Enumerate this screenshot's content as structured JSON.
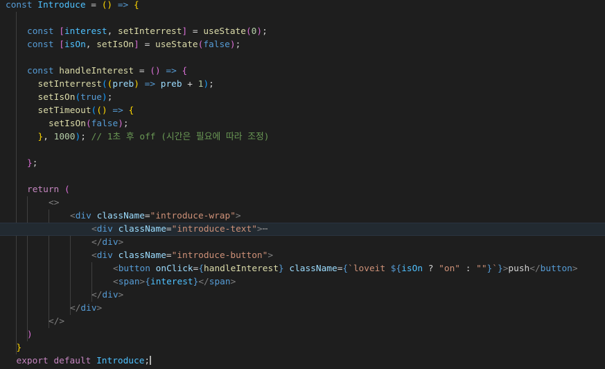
{
  "colors": {
    "background": "#1e1e1e",
    "keyword": "#569cd6",
    "control": "#c586c0",
    "function": "#dcdcaa",
    "variable": "#9cdcfe",
    "const_var": "#4fc1ff",
    "string": "#ce9178",
    "number": "#b5cea8",
    "comment": "#6a9955",
    "tag": "#569cd6",
    "tag_bracket": "#808080",
    "bracket_1": "#ffd700",
    "bracket_2": "#da70d6",
    "bracket_3": "#179fff",
    "text": "#d4d4d4"
  },
  "lines": [
    {
      "indent": 0,
      "tokens": [
        [
          "const ",
          "keyword"
        ],
        [
          "Introduce",
          "const_var"
        ],
        [
          " = ",
          "text"
        ],
        [
          "(",
          "bracket_1"
        ],
        [
          ")",
          "bracket_1"
        ],
        [
          " => ",
          "keyword"
        ],
        [
          "{",
          "bracket_1"
        ]
      ]
    },
    {
      "indent": 0,
      "tokens": []
    },
    {
      "indent": 2,
      "tokens": [
        [
          "const ",
          "keyword"
        ],
        [
          "[",
          "bracket_2"
        ],
        [
          "interest",
          "const_var"
        ],
        [
          ", ",
          "text"
        ],
        [
          "setInterrest",
          "function"
        ],
        [
          "]",
          "bracket_2"
        ],
        [
          " = ",
          "text"
        ],
        [
          "useState",
          "function"
        ],
        [
          "(",
          "bracket_2"
        ],
        [
          "0",
          "number"
        ],
        [
          ")",
          "bracket_2"
        ],
        [
          ";",
          "text"
        ]
      ]
    },
    {
      "indent": 2,
      "tokens": [
        [
          "const ",
          "keyword"
        ],
        [
          "[",
          "bracket_2"
        ],
        [
          "isOn",
          "const_var"
        ],
        [
          ", ",
          "text"
        ],
        [
          "setIsOn",
          "function"
        ],
        [
          "]",
          "bracket_2"
        ],
        [
          " = ",
          "text"
        ],
        [
          "useState",
          "function"
        ],
        [
          "(",
          "bracket_2"
        ],
        [
          "false",
          "keyword"
        ],
        [
          ")",
          "bracket_2"
        ],
        [
          ";",
          "text"
        ]
      ]
    },
    {
      "indent": 0,
      "tokens": []
    },
    {
      "indent": 2,
      "tokens": [
        [
          "const ",
          "keyword"
        ],
        [
          "handleInterest",
          "function"
        ],
        [
          " = ",
          "text"
        ],
        [
          "(",
          "bracket_2"
        ],
        [
          ")",
          "bracket_2"
        ],
        [
          " => ",
          "keyword"
        ],
        [
          "{",
          "bracket_2"
        ]
      ]
    },
    {
      "indent": 3,
      "tokens": [
        [
          "setInterrest",
          "function"
        ],
        [
          "(",
          "bracket_3"
        ],
        [
          "(",
          "bracket_1"
        ],
        [
          "preb",
          "variable"
        ],
        [
          ")",
          "bracket_1"
        ],
        [
          " => ",
          "keyword"
        ],
        [
          "preb",
          "variable"
        ],
        [
          " + ",
          "text"
        ],
        [
          "1",
          "number"
        ],
        [
          ")",
          "bracket_3"
        ],
        [
          ";",
          "text"
        ]
      ]
    },
    {
      "indent": 3,
      "tokens": [
        [
          "setIsOn",
          "function"
        ],
        [
          "(",
          "bracket_3"
        ],
        [
          "true",
          "keyword"
        ],
        [
          ")",
          "bracket_3"
        ],
        [
          ";",
          "text"
        ]
      ]
    },
    {
      "indent": 3,
      "tokens": [
        [
          "setTimeout",
          "function"
        ],
        [
          "(",
          "bracket_3"
        ],
        [
          "(",
          "bracket_1"
        ],
        [
          ")",
          "bracket_1"
        ],
        [
          " => ",
          "keyword"
        ],
        [
          "{",
          "bracket_1"
        ]
      ]
    },
    {
      "indent": 4,
      "tokens": [
        [
          "setIsOn",
          "function"
        ],
        [
          "(",
          "bracket_2"
        ],
        [
          "false",
          "keyword"
        ],
        [
          ")",
          "bracket_2"
        ],
        [
          ";",
          "text"
        ]
      ]
    },
    {
      "indent": 3,
      "tokens": [
        [
          "}",
          "bracket_1"
        ],
        [
          ", ",
          "text"
        ],
        [
          "1000",
          "number"
        ],
        [
          ")",
          "bracket_3"
        ],
        [
          ";",
          "text"
        ],
        [
          " // 1초 후 off (시간은 필요에 따라 조정)",
          "comment"
        ]
      ]
    },
    {
      "indent": 0,
      "tokens": []
    },
    {
      "indent": 2,
      "tokens": [
        [
          "}",
          "bracket_2"
        ],
        [
          ";",
          "text"
        ]
      ]
    },
    {
      "indent": 0,
      "tokens": []
    },
    {
      "indent": 2,
      "tokens": [
        [
          "return ",
          "control"
        ],
        [
          "(",
          "bracket_2"
        ]
      ]
    },
    {
      "indent": 4,
      "tokens": [
        [
          "<>",
          "tag_bracket"
        ]
      ]
    },
    {
      "indent": 6,
      "tokens": [
        [
          "<",
          "tag_bracket"
        ],
        [
          "div",
          "tag"
        ],
        [
          " ",
          "text"
        ],
        [
          "className",
          "variable"
        ],
        [
          "=",
          "text"
        ],
        [
          "\"introduce-wrap\"",
          "string"
        ],
        [
          ">",
          "tag_bracket"
        ]
      ]
    },
    {
      "indent": 8,
      "highlight": true,
      "tokens": [
        [
          "<",
          "tag_bracket"
        ],
        [
          "div",
          "tag"
        ],
        [
          " ",
          "text"
        ],
        [
          "className",
          "variable"
        ],
        [
          "=",
          "text"
        ],
        [
          "\"introduce-text\"",
          "string"
        ],
        [
          ">",
          "tag_bracket"
        ],
        [
          "⋯",
          "ellipsis"
        ]
      ]
    },
    {
      "indent": 8,
      "tokens": [
        [
          "</",
          "tag_bracket"
        ],
        [
          "div",
          "tag"
        ],
        [
          ">",
          "tag_bracket"
        ]
      ]
    },
    {
      "indent": 8,
      "tokens": [
        [
          "<",
          "tag_bracket"
        ],
        [
          "div",
          "tag"
        ],
        [
          " ",
          "text"
        ],
        [
          "className",
          "variable"
        ],
        [
          "=",
          "text"
        ],
        [
          "\"introduce-button\"",
          "string"
        ],
        [
          ">",
          "tag_bracket"
        ]
      ]
    },
    {
      "indent": 10,
      "tokens": [
        [
          "<",
          "tag_bracket"
        ],
        [
          "button",
          "tag"
        ],
        [
          " ",
          "text"
        ],
        [
          "onClick",
          "variable"
        ],
        [
          "=",
          "text"
        ],
        [
          "{",
          "keyword"
        ],
        [
          "handleInterest",
          "function"
        ],
        [
          "}",
          "keyword"
        ],
        [
          " ",
          "text"
        ],
        [
          "className",
          "variable"
        ],
        [
          "=",
          "text"
        ],
        [
          "{",
          "keyword"
        ],
        [
          "`loveit ",
          "string"
        ],
        [
          "${",
          "keyword"
        ],
        [
          "isOn",
          "const_var"
        ],
        [
          " ? ",
          "text"
        ],
        [
          "\"on\"",
          "string"
        ],
        [
          " : ",
          "text"
        ],
        [
          "\"\"",
          "string"
        ],
        [
          "}",
          "keyword"
        ],
        [
          "`",
          "string"
        ],
        [
          "}",
          "keyword"
        ],
        [
          ">",
          "tag_bracket"
        ],
        [
          "push",
          "text"
        ],
        [
          "</",
          "tag_bracket"
        ],
        [
          "button",
          "tag"
        ],
        [
          ">",
          "tag_bracket"
        ]
      ]
    },
    {
      "indent": 10,
      "tokens": [
        [
          "<",
          "tag_bracket"
        ],
        [
          "span",
          "tag"
        ],
        [
          ">",
          "tag_bracket"
        ],
        [
          "{",
          "keyword"
        ],
        [
          "interest",
          "const_var"
        ],
        [
          "}",
          "keyword"
        ],
        [
          "</",
          "tag_bracket"
        ],
        [
          "span",
          "tag"
        ],
        [
          ">",
          "tag_bracket"
        ]
      ]
    },
    {
      "indent": 8,
      "tokens": [
        [
          "</",
          "tag_bracket"
        ],
        [
          "div",
          "tag"
        ],
        [
          ">",
          "tag_bracket"
        ]
      ]
    },
    {
      "indent": 6,
      "tokens": [
        [
          "</",
          "tag_bracket"
        ],
        [
          "div",
          "tag"
        ],
        [
          ">",
          "tag_bracket"
        ]
      ]
    },
    {
      "indent": 4,
      "tokens": [
        [
          "</>",
          "tag_bracket"
        ]
      ]
    },
    {
      "indent": 2,
      "tokens": [
        [
          ")",
          "bracket_2"
        ]
      ]
    },
    {
      "indent": 1,
      "tokens": [
        [
          "}",
          "bracket_1"
        ]
      ]
    },
    {
      "indent": 1,
      "cursor_end": true,
      "tokens": [
        [
          "export ",
          "control"
        ],
        [
          "default ",
          "control"
        ],
        [
          "Introduce",
          "const_var"
        ],
        [
          ";",
          "text"
        ]
      ]
    }
  ]
}
